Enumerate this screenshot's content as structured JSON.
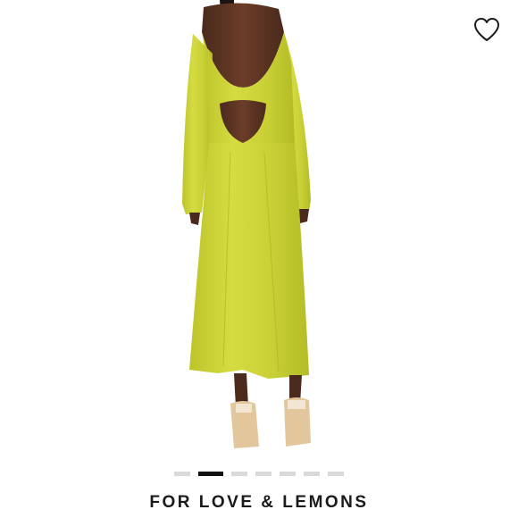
{
  "product": {
    "brand": "FOR LOVE & LEMONS",
    "image_description_icon": "product-photo-dress-back",
    "dress_color": "#cdd636"
  },
  "wishlist": {
    "icon": "heart-outline-icon"
  },
  "carousel": {
    "total": 7,
    "active_index": 1
  }
}
